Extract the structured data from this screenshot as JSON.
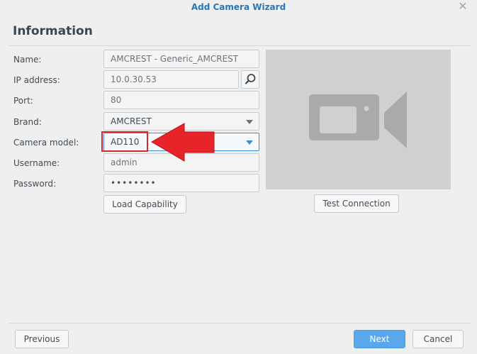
{
  "window": {
    "title": "Add Camera Wizard",
    "close_icon": "close-icon"
  },
  "section": {
    "title": "Information"
  },
  "form": {
    "name": {
      "label": "Name:",
      "value": "AMCREST - Generic_AMCREST"
    },
    "ip": {
      "label": "IP address:",
      "value": "10.0.30.53"
    },
    "port": {
      "label": "Port:",
      "value": "80"
    },
    "brand": {
      "label": "Brand:",
      "value": "AMCREST"
    },
    "model": {
      "label": "Camera model:",
      "value": "AD110"
    },
    "username": {
      "label": "Username:",
      "value": "admin"
    },
    "password": {
      "label": "Password:",
      "value": "••••••••"
    }
  },
  "buttons": {
    "load_capability": "Load Capability",
    "test_connection": "Test Connection",
    "previous": "Previous",
    "next": "Next",
    "cancel": "Cancel"
  },
  "icons": {
    "search": "search-icon",
    "camera": "video-camera-icon",
    "annotation": "red-arrow-annotation"
  },
  "colors": {
    "accent": "#2a77b8",
    "primary_button": "#5aa8ec",
    "annotation_red": "#d9252b",
    "preview_bg": "#cfd0d1"
  }
}
